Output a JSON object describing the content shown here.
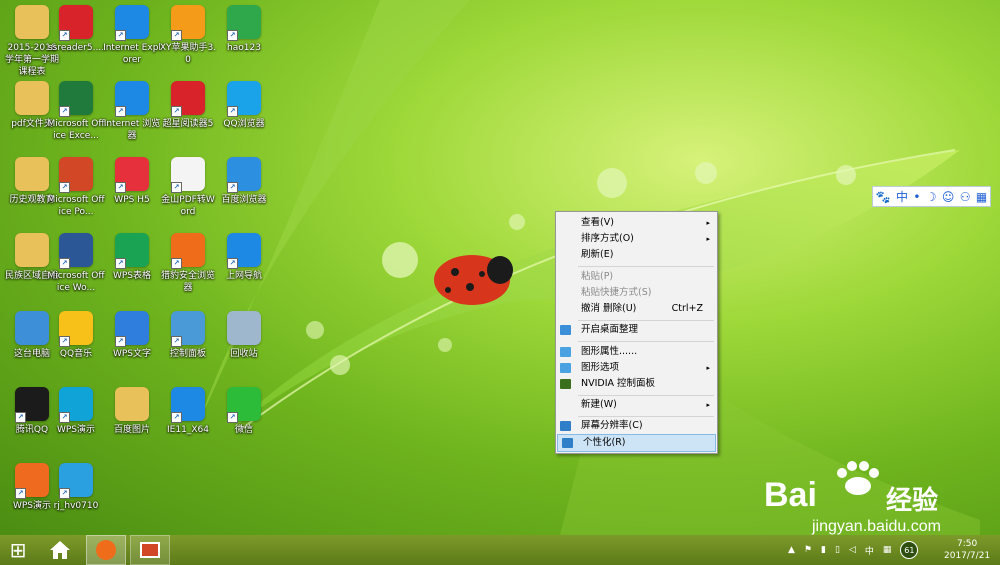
{
  "desktop": {
    "icons": [
      {
        "label": "2015-2016学年第一学期课程表",
        "icon": "folder-icon",
        "color": "#e8c15a"
      },
      {
        "label": "ssreader5....",
        "icon": "ssreader-icon",
        "color": "#d8232a"
      },
      {
        "label": "Internet Explorer",
        "icon": "ie-icon",
        "color": "#1e88e5"
      },
      {
        "label": "XY苹果助手3.0",
        "icon": "xy-assistant-icon",
        "color": "#f59b1a"
      },
      {
        "label": "hao123",
        "icon": "hao123-icon",
        "color": "#2ea84a"
      },
      {
        "label": "pdf文件夹",
        "icon": "folder-icon",
        "color": "#e8c15a"
      },
      {
        "label": "Microsoft Office Exce...",
        "icon": "excel-icon",
        "color": "#1f7a3c"
      },
      {
        "label": "Internet 浏览器",
        "icon": "ie-icon",
        "color": "#1e88e5"
      },
      {
        "label": "超星阅读器5",
        "icon": "ssreader-icon",
        "color": "#d8232a"
      },
      {
        "label": "QQ浏览器",
        "icon": "qq-browser-icon",
        "color": "#1aa3e8"
      },
      {
        "label": "历史观教育",
        "icon": "folder-icon",
        "color": "#e8c15a"
      },
      {
        "label": "Microsoft Office Po...",
        "icon": "powerpoint-icon",
        "color": "#d24726"
      },
      {
        "label": "WPS H5",
        "icon": "wps-h5-icon",
        "color": "#e6313c"
      },
      {
        "label": "金山PDF转Word",
        "icon": "document-icon",
        "color": "#f4f4f4"
      },
      {
        "label": "百度浏览器",
        "icon": "baidu-browser-icon",
        "color": "#2c8fe0"
      },
      {
        "label": "民族区域自治",
        "icon": "folder-icon",
        "color": "#e8c15a"
      },
      {
        "label": "Microsoft Office Wo...",
        "icon": "word-icon",
        "color": "#2b5797"
      },
      {
        "label": "WPS表格",
        "icon": "wps-spreadsheet-icon",
        "color": "#1aa352"
      },
      {
        "label": "猎豹安全浏览器",
        "icon": "liebao-browser-icon",
        "color": "#ef6c1a"
      },
      {
        "label": "上网导航",
        "icon": "ie-icon",
        "color": "#1e88e5"
      },
      {
        "label": "这台电脑",
        "icon": "computer-icon",
        "color": "#3d8fd8"
      },
      {
        "label": "QQ音乐",
        "icon": "qq-music-icon",
        "color": "#f8c11a"
      },
      {
        "label": "WPS文字",
        "icon": "wps-writer-icon",
        "color": "#2f7ddc"
      },
      {
        "label": "控制面板",
        "icon": "control-panel-icon",
        "color": "#4a9ad8"
      },
      {
        "label": "回收站",
        "icon": "recycle-bin-icon",
        "color": "#9fb7cc"
      },
      {
        "label": "腾讯QQ",
        "icon": "qq-icon",
        "color": "#1b1b1b"
      },
      {
        "label": "WPS演示",
        "icon": "wps-presentation-icon",
        "color": "#0fa3d8"
      },
      {
        "label": "百度图片",
        "icon": "folder-icon",
        "color": "#e8c15a"
      },
      {
        "label": "IE11_X64",
        "icon": "ie-icon",
        "color": "#1e88e5"
      },
      {
        "label": "微信",
        "icon": "wechat-icon",
        "color": "#2dbb3a"
      },
      {
        "label": "WPS演示",
        "icon": "wps-presentation-icon",
        "color": "#ef6a1f"
      },
      {
        "label": "rj_hv0710",
        "icon": "paw-icon",
        "color": "#2aa0e0"
      }
    ]
  },
  "ime": {
    "items": [
      "🐾",
      "中",
      "•",
      "☽",
      "☺",
      "⚇",
      "▦"
    ]
  },
  "context_menu": {
    "items": [
      {
        "label": "查看(V)",
        "arrow": "▸"
      },
      {
        "label": "排序方式(O)",
        "arrow": "▸"
      },
      {
        "label": "刷新(E)"
      },
      {
        "label": "粘贴(P)",
        "disabled": true
      },
      {
        "label": "粘贴快捷方式(S)",
        "disabled": true
      },
      {
        "label": "撤消 删除(U)",
        "shortcut": "Ctrl+Z"
      },
      {
        "label": "开启桌面整理",
        "icon": "desktop-organize-icon"
      },
      {
        "label": "图形属性......",
        "icon": "graphics-properties-icon"
      },
      {
        "label": "图形选项",
        "icon": "graphics-options-icon",
        "arrow": "▸"
      },
      {
        "label": "NVIDIA 控制面板",
        "icon": "nvidia-icon"
      },
      {
        "label": "新建(W)",
        "arrow": "▸"
      },
      {
        "label": "屏幕分辨率(C)",
        "icon": "screen-resolution-icon"
      },
      {
        "label": "个性化(R)",
        "icon": "personalize-icon",
        "highlighted": true
      }
    ]
  },
  "watermark": {
    "logo": "Bai",
    "logo_cn": "经验",
    "url": "jingyan.baidu.com"
  },
  "taskbar": {
    "start": "⊞",
    "tray_icons": [
      "▲",
      "⚑",
      "▮",
      "▯",
      "◁",
      "中",
      "▦"
    ],
    "badge": "61",
    "time": "7:50",
    "date": "2017/7/21"
  },
  "colors": {
    "menu_highlight": "#cde4f7",
    "taskbar": "#6f8f23"
  }
}
